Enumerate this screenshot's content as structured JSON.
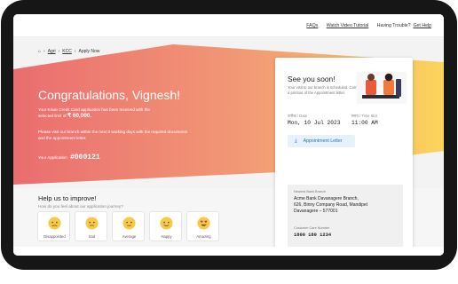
{
  "header": {
    "faqs": "FAQs",
    "tutorial": "Watch Video Tutorial",
    "trouble_text": "Having Trouble?",
    "help_link": "Get Help"
  },
  "breadcrumb": {
    "home_icon": "home-icon",
    "items": [
      "Agri",
      "KCC",
      "Apply Now"
    ]
  },
  "banner": {
    "title": "Congratulations, Vignesh!",
    "line1": "Your Kisan Credit Card application has been received with the",
    "line2_prefix": "selected limit of",
    "limit_amount": "₹ 60,000.",
    "visit_line1": "Please visit our branch within the next 3 working days with the required documents",
    "visit_line2": "and the appointment letter.",
    "app_label": "Your Application",
    "app_number": "#000121",
    "colors": {
      "start": "#ea6d6f",
      "mid": "#f39b75",
      "end": "#fbd35a"
    }
  },
  "card": {
    "heading": "See you soon!",
    "para": "Your visit to our branch is scheduled. Carry a printout of the Appointment letter.",
    "date_label": "तारीख / Date",
    "date_value": "Mon, 10 Jul 2023",
    "time_label": "समय / Time Slot",
    "time_value": "11:00 AM",
    "button_label": "Appointment Letter",
    "button_icon": "download-icon",
    "branch_label": "Nearest Bank Branch",
    "branch_lines": [
      "Acme Bank Davanagere Branch,",
      "626, Binny Company Road, Mandipet",
      "Davanagere – 577001"
    ],
    "care_label": "Customer Care Number",
    "care_number": "1800 180 1234"
  },
  "feedback": {
    "title": "Help us to improve!",
    "question": "How do you feel about our application journey?",
    "options": [
      {
        "label": "Disappointed",
        "icon": "disappointed-face-icon"
      },
      {
        "label": "Sad",
        "icon": "sad-face-icon"
      },
      {
        "label": "Average",
        "icon": "neutral-face-icon"
      },
      {
        "label": "Happy",
        "icon": "happy-face-icon"
      },
      {
        "label": "Amazing",
        "icon": "heart-eyes-face-icon"
      }
    ]
  }
}
